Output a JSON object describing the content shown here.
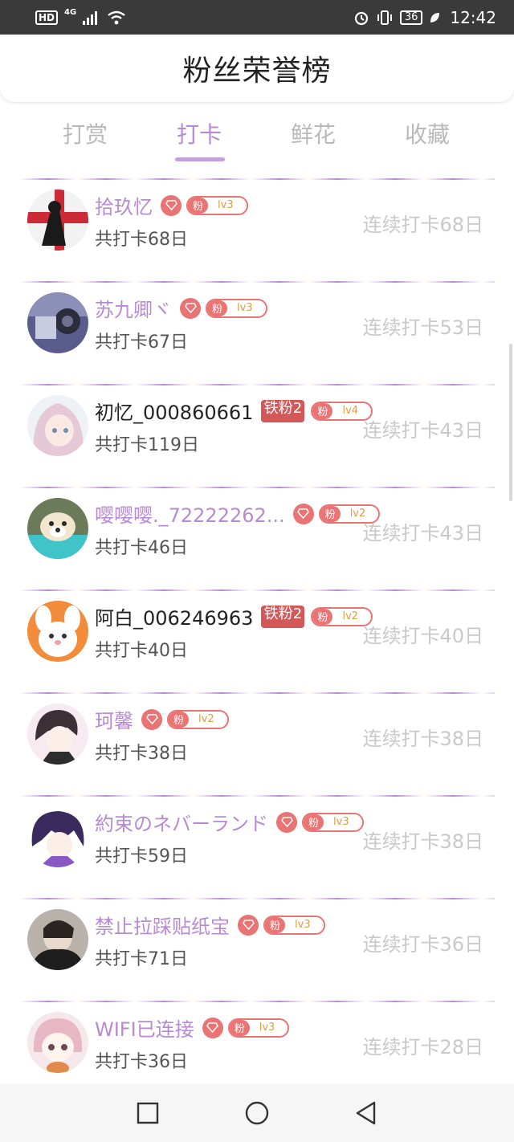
{
  "status_bar": {
    "hd": "HD",
    "network": "4G",
    "battery": "36",
    "time": "12:42"
  },
  "header": {
    "title": "粉丝荣誉榜"
  },
  "tabs": [
    {
      "label": "打赏",
      "active": false
    },
    {
      "label": "打卡",
      "active": true
    },
    {
      "label": "鲜花",
      "active": false
    },
    {
      "label": "收藏",
      "active": false
    }
  ],
  "fan_label": "粉",
  "items": [
    {
      "name": "拾玖忆",
      "name_dark": false,
      "badge": "diamond",
      "level": "lv3",
      "total": "共打卡68日",
      "streak": "连续打卡68日",
      "avatar": "avatar-redcross"
    },
    {
      "name": "苏九卿ヾ",
      "name_dark": false,
      "badge": "diamond",
      "level": "lv3",
      "total": "共打卡67日",
      "streak": "连续打卡53日",
      "avatar": "avatar-camera"
    },
    {
      "name": "初忆_000860661",
      "name_dark": true,
      "badge": "iron",
      "badge_text": "铁粉2",
      "level": "lv4",
      "total": "共打卡119日",
      "streak": "连续打卡43日",
      "avatar": "avatar-anime-girl"
    },
    {
      "name": "嘤嘤嘤._72222262...",
      "name_dark": false,
      "badge": "diamond",
      "level": "lv2",
      "total": "共打卡46日",
      "streak": "连续打卡43日",
      "avatar": "avatar-dog"
    },
    {
      "name": "阿白_006246963",
      "name_dark": true,
      "badge": "iron",
      "badge_text": "铁粉2",
      "level": "lv2",
      "total": "共打卡40日",
      "streak": "连续打卡40日",
      "avatar": "avatar-bunny"
    },
    {
      "name": "珂馨",
      "name_dark": false,
      "badge": "diamond",
      "level": "lv2",
      "total": "共打卡38日",
      "streak": "连续打卡38日",
      "avatar": "avatar-anime-boy"
    },
    {
      "name": "約束のネバーランド",
      "name_dark": false,
      "badge": "diamond",
      "level": "lv3",
      "total": "共打卡59日",
      "streak": "连续打卡38日",
      "avatar": "avatar-purple-hair"
    },
    {
      "name": "禁止拉踩贴纸宝",
      "name_dark": false,
      "badge": "diamond",
      "level": "lv3",
      "total": "共打卡71日",
      "streak": "连续打卡36日",
      "avatar": "avatar-dark-photo"
    },
    {
      "name": "WIFI已连接",
      "name_dark": false,
      "badge": "diamond",
      "level": "lv3",
      "total": "共打卡36日",
      "streak": "连续打卡28日",
      "avatar": "avatar-chibi"
    }
  ]
}
